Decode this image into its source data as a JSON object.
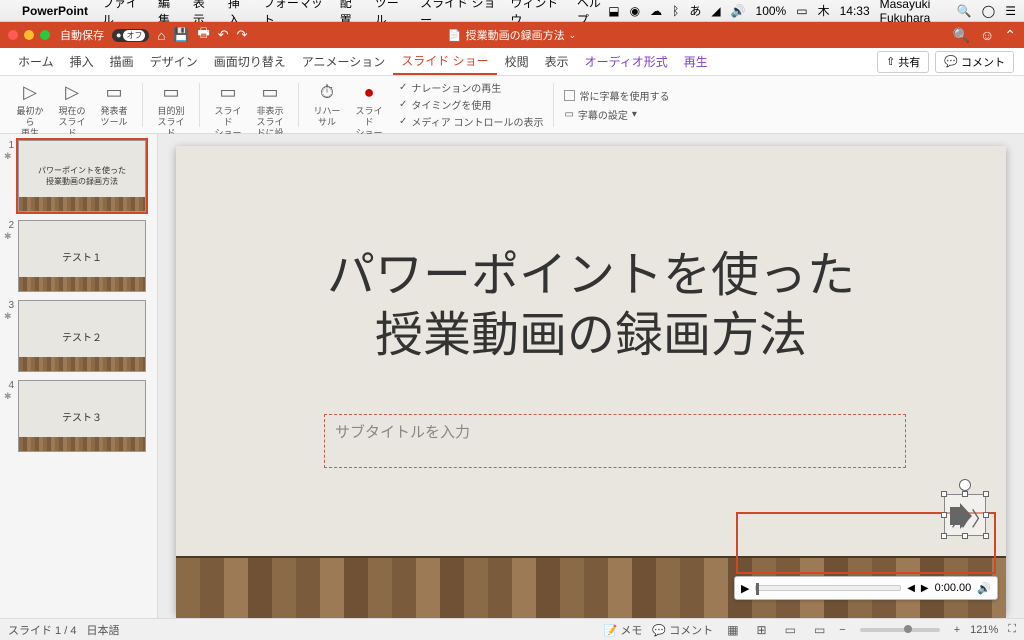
{
  "mac_menu": {
    "app": "PowerPoint",
    "items": [
      "ファイル",
      "編集",
      "表示",
      "挿入",
      "フォーマット",
      "配置",
      "ツール",
      "スライド ショー",
      "ウィンドウ",
      "ヘルプ"
    ],
    "battery": "100%",
    "day": "木",
    "time": "14:33",
    "user": "Masayuki Fukuhara"
  },
  "titlebar": {
    "autosave_label": "自動保存",
    "autosave_state": "オフ",
    "doc_name": "授業動画の録画方法"
  },
  "tabs": {
    "items": [
      "ホーム",
      "挿入",
      "描画",
      "デザイン",
      "画面切り替え",
      "アニメーション",
      "スライド ショー",
      "校閲",
      "表示"
    ],
    "aux": [
      "オーディオ形式",
      "再生"
    ],
    "active": "スライド ショー",
    "share": "共有",
    "comments": "コメント"
  },
  "ribbon": {
    "btn1": "最初から\n再生",
    "btn2": "現在のスライド\nから再生",
    "btn3": "発表者\nツール",
    "btn4": "目的別スライド\nショー",
    "btn5": "スライド\nショーの設定",
    "btn6": "非表示\nスライドに設定",
    "btn7": "リハーサル",
    "btn8": "スライド\nショーの記録",
    "chk1": "ナレーションの再生",
    "chk2": "タイミングを使用",
    "chk3": "メディア コントロールの表示",
    "ctrl1": "常に字幕を使用する",
    "ctrl2": "字幕の設定"
  },
  "thumbs": [
    {
      "n": "1",
      "text": "パワーポイントを使った\n授業動画の録画方法",
      "selected": true
    },
    {
      "n": "2",
      "text": "テスト１",
      "selected": false
    },
    {
      "n": "3",
      "text": "テスト２",
      "selected": false
    },
    {
      "n": "4",
      "text": "テスト３",
      "selected": false
    }
  ],
  "slide": {
    "title": "パワーポイントを使った\n授業動画の録画方法",
    "subtitle_placeholder": "サブタイトルを入力"
  },
  "audio": {
    "time": "0:00.00"
  },
  "status": {
    "slide_pos": "スライド 1 / 4",
    "lang": "日本語",
    "notes": "メモ",
    "comments": "コメント",
    "zoom": "121%"
  }
}
